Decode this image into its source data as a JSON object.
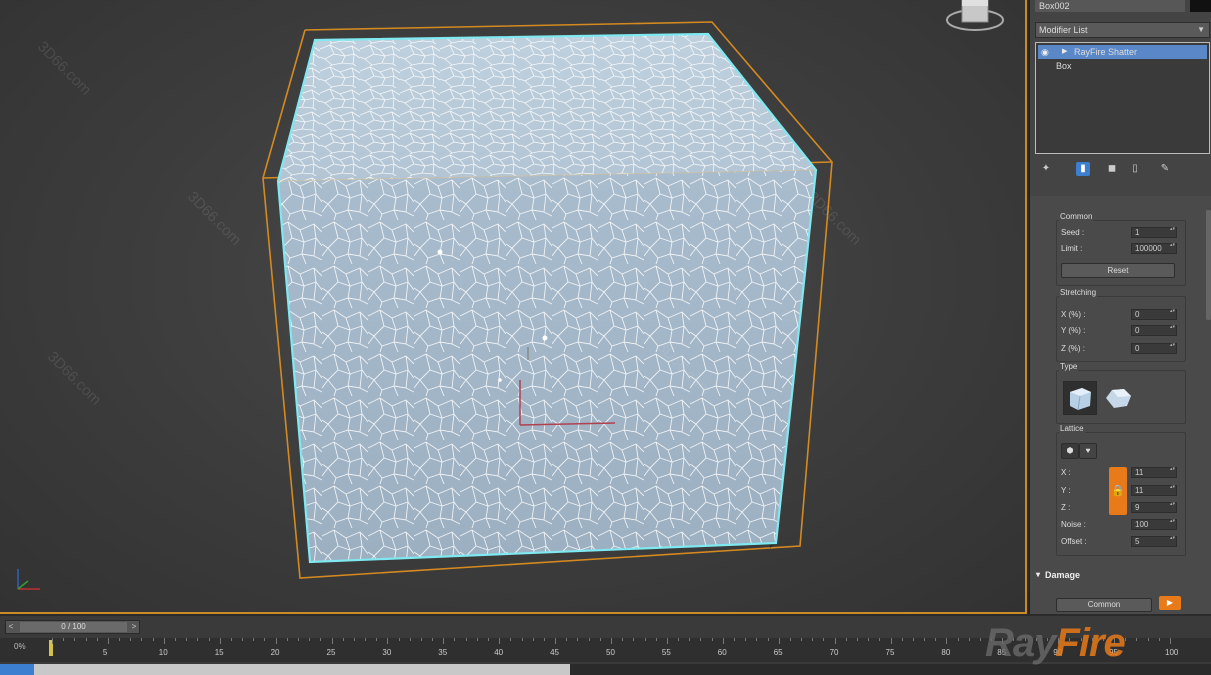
{
  "panel": {
    "object_name": "Box002",
    "modifier_list": "Modifier List",
    "stack": [
      {
        "label": "RayFire Shatter",
        "selected": true
      },
      {
        "label": "Box",
        "selected": false
      }
    ]
  },
  "common": {
    "title": "Common",
    "seed_label": "Seed :",
    "seed_value": "1",
    "limit_label": "Limit :",
    "limit_value": "100000",
    "reset_label": "Reset"
  },
  "stretching": {
    "title": "Stretching",
    "x_label": "X (%) :",
    "x_value": "0",
    "y_label": "Y (%) :",
    "y_value": "0",
    "z_label": "Z (%) :",
    "z_value": "0"
  },
  "type": {
    "title": "Type"
  },
  "lattice": {
    "title": "Lattice",
    "x_label": "X :",
    "x_value": "11",
    "y_label": "Y :",
    "y_value": "11",
    "z_label": "Z :",
    "z_value": "9",
    "noise_label": "Noise :",
    "noise_value": "100",
    "offset_label": "Offset :",
    "offset_value": "5"
  },
  "damage": {
    "title": "Damage",
    "button_label": "Common"
  },
  "timeline": {
    "frame_display": "0 / 100",
    "percent": "0%",
    "ticks": [
      "5",
      "10",
      "15",
      "20",
      "25",
      "30",
      "35",
      "40",
      "45",
      "50",
      "55",
      "60",
      "65",
      "70",
      "75",
      "80",
      "85",
      "90",
      "95",
      "100"
    ]
  },
  "logo": {
    "part1": "Ray",
    "part2": "Fire"
  },
  "watermarks": [
    "3D66.com",
    "3D66.com",
    "3D66.com",
    "3D66.com",
    "3D66.com",
    "3D66.com"
  ],
  "colors": {
    "selection_cyan": "#7fe8f0",
    "bbox_orange": "#d48a20",
    "accent_orange": "#e87a1a",
    "highlight_blue": "#5a87c8"
  }
}
